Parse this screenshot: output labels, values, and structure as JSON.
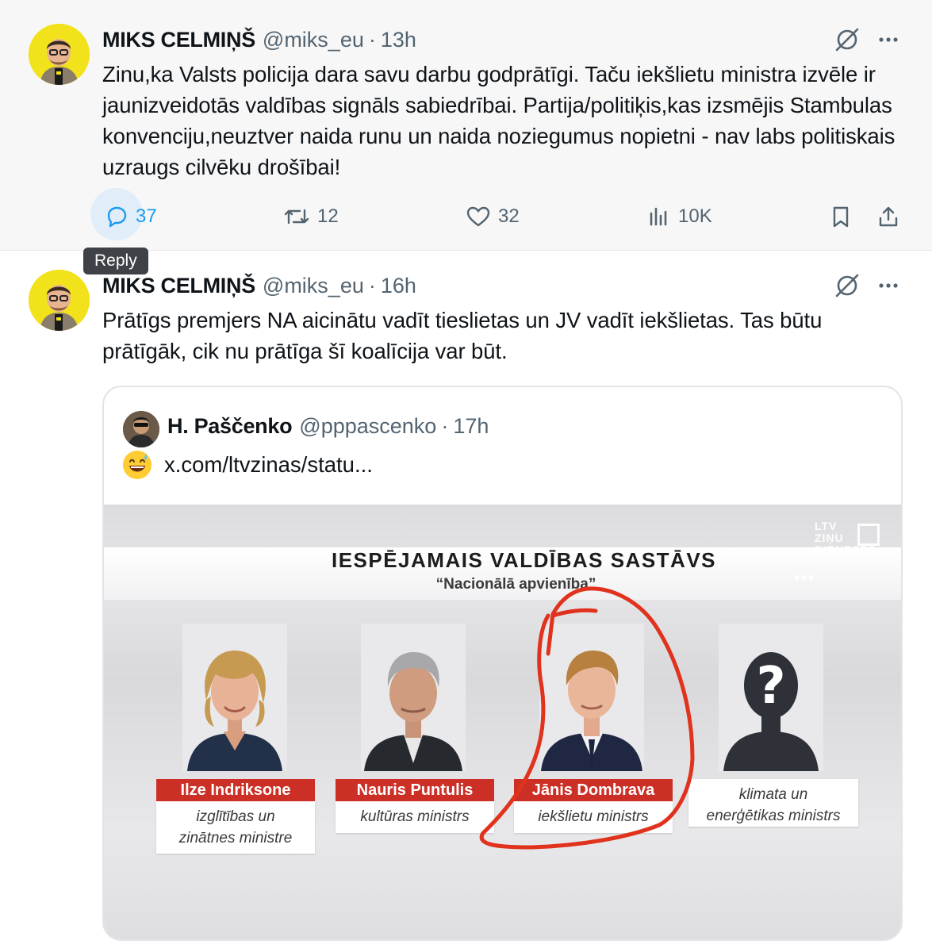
{
  "tweet1": {
    "author": "MIKS CELMIŅŠ",
    "handle": "@miks_eu",
    "separator": "·",
    "time": "13h",
    "text": "Zinu,ka Valsts policija dara savu darbu godprātīgi. Taču iekšlietu ministra izvēle ir jaunizveidotās valdības signāls sabiedrībai. Partija/politiķis,kas izsmējis Stambulas konvenciju,neuztver naida runu un naida noziegumus nopietni - nav labs politiskais uzraugs cilvēku drošībai!",
    "replies": "37",
    "reposts": "12",
    "likes": "32",
    "views": "10K",
    "tooltip": "Reply"
  },
  "tweet2": {
    "author": "MIKS CELMIŅŠ",
    "handle": "@miks_eu",
    "separator": "·",
    "time": "16h",
    "text": "Prātīgs premjers NA aicinātu vadīt tieslietas un JV vadīt iekšlietas. Tas būtu prātīgāk, cik nu prātīga šī koalīcija var būt.",
    "quote": {
      "author": "H. Paščenko",
      "handle": "@pppascenko",
      "separator": "·",
      "time": "17h",
      "link": "x.com/ltvzinas/statu...",
      "media": {
        "title": "IESPĒJAMAIS VALDĪBAS SASTĀVS",
        "subtitle": "“Nacionālā apvienība”",
        "logo_lines": [
          "LTV",
          "ZIŅU",
          "DIENESTS"
        ],
        "people": [
          {
            "name": "Ilze Indriksone",
            "role_line1": "izglītības un",
            "role_line2": "zinātnes ministre"
          },
          {
            "name": "Nauris Puntulis",
            "role_line1": "kultūras ministrs",
            "role_line2": ""
          },
          {
            "name": "Jānis Dombrava",
            "role_line1": "iekšlietu ministrs",
            "role_line2": ""
          },
          {
            "name": "",
            "role_line1": "klimata un",
            "role_line2": "enerģētikas ministrs",
            "unknown_mark": "?"
          }
        ]
      }
    }
  },
  "colors": {
    "accent": "#1d9bf0",
    "muted": "#536471",
    "avatar_bg": "#f2e21c",
    "nameplate_red": "#cc2f26",
    "circle_red": "#e0321d"
  },
  "icons": [
    "grok-icon",
    "more-icon",
    "reply-icon",
    "repost-icon",
    "like-icon",
    "views-icon",
    "bookmark-icon",
    "share-icon"
  ]
}
